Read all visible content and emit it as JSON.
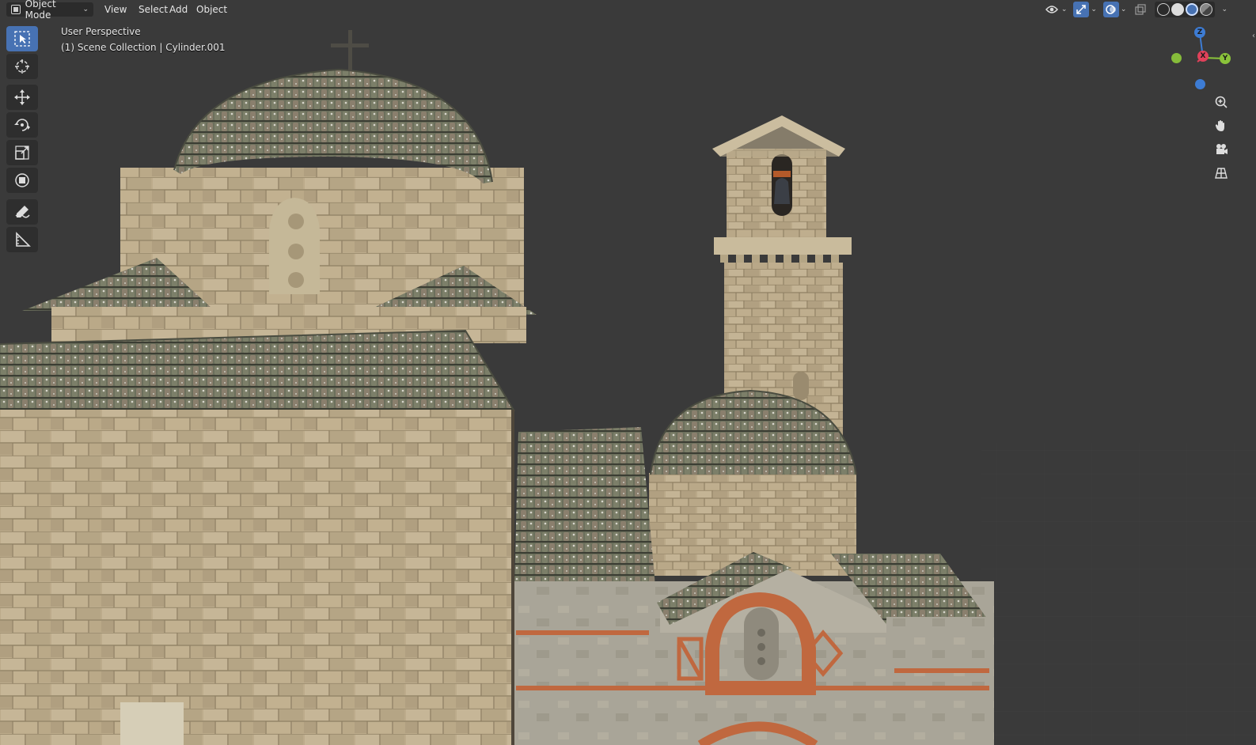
{
  "header": {
    "mode_label": "Object Mode",
    "menus": [
      "View",
      "Select",
      "Add",
      "Object"
    ]
  },
  "overlay": {
    "view_name": "User Perspective",
    "collection_info": "(1) Scene Collection | Cylinder.001"
  },
  "toolbar": {
    "tools": [
      "select-box",
      "cursor",
      "move",
      "rotate",
      "scale",
      "transform",
      "annotate",
      "measure"
    ],
    "active": "select-box"
  },
  "gizmo": {
    "axes": [
      "Z",
      "X",
      "Y"
    ],
    "colors": {
      "x": "#e0415a",
      "y": "#8ac33a",
      "z": "#3d7cd4"
    }
  },
  "navigation": [
    "zoom-icon",
    "pan-hand-icon",
    "camera-icon",
    "grid-ortho-icon"
  ],
  "theme": {
    "accent": "#4772b3",
    "background": "#3a3a3a"
  }
}
